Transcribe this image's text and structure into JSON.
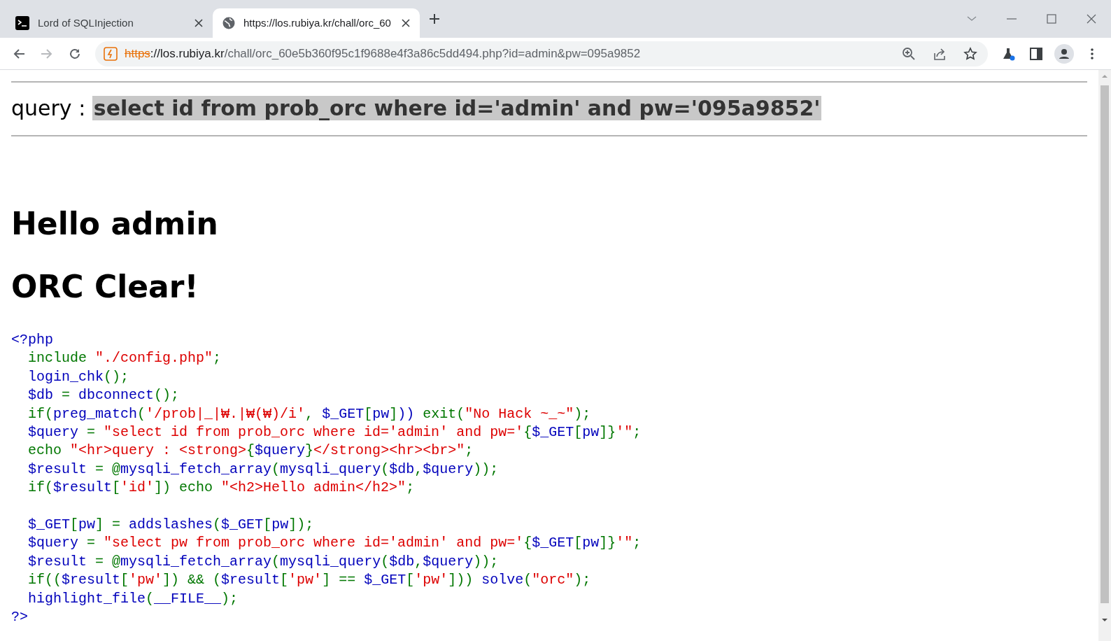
{
  "browser": {
    "tabs": [
      {
        "title": "Lord of SQLInjection",
        "selected": false
      },
      {
        "title": "https://los.rubiya.kr/chall/orc_60",
        "selected": true
      }
    ],
    "nav": {
      "back_enabled": true,
      "forward_enabled": false
    },
    "address": {
      "scheme": "https",
      "insecure": true,
      "host": "://los.rubiya.kr",
      "path": "/chall/orc_60e5b360f95c1f9688e4f3a86c5dd494.php?id=admin&pw=095a9852"
    }
  },
  "page": {
    "query": "query : **select id from prob_orc where id='admin' and pw='095a9852'**",
    "headings": [
      "Hello admin",
      "ORC Clear!"
    ],
    "code": [
      {
        "kind": "code",
        "tokens": [
          {
            "text": "<?php",
            "kind": "default"
          }
        ]
      },
      {
        "kind": "code",
        "tokens": [
          {
            "text": "  include ",
            "kind": "keyword"
          },
          {
            "text": "\"./config.php\"",
            "kind": "string"
          },
          {
            "text": ";",
            "kind": "keyword"
          }
        ]
      },
      {
        "kind": "code",
        "tokens": [
          {
            "text": "  login_chk",
            "kind": "default"
          },
          {
            "text": "();",
            "kind": "keyword"
          }
        ]
      },
      {
        "kind": "code",
        "tokens": [
          {
            "text": "  $db ",
            "kind": "default"
          },
          {
            "text": "= ",
            "kind": "keyword"
          },
          {
            "text": "dbconnect",
            "kind": "default"
          },
          {
            "text": "();",
            "kind": "keyword"
          }
        ]
      },
      {
        "kind": "code",
        "tokens": [
          {
            "text": "  if(",
            "kind": "keyword"
          },
          {
            "text": "preg_match",
            "kind": "default"
          },
          {
            "text": "(",
            "kind": "keyword"
          },
          {
            "text": "'/prob|_|₩.|₩(₩)/i'",
            "kind": "string"
          },
          {
            "text": ", ",
            "kind": "keyword"
          },
          {
            "text": "$_GET",
            "kind": "default"
          },
          {
            "text": "[",
            "kind": "keyword"
          },
          {
            "text": "pw",
            "kind": "default"
          },
          {
            "text": "]",
            "kind": "keyword"
          },
          {
            "text": "))",
            "kind": "default"
          },
          {
            "text": " exit(",
            "kind": "keyword"
          },
          {
            "text": "\"No Hack ~_~\"",
            "kind": "string"
          },
          {
            "text": ");",
            "kind": "keyword"
          }
        ]
      },
      {
        "kind": "code",
        "tokens": [
          {
            "text": "  $query ",
            "kind": "default"
          },
          {
            "text": "= ",
            "kind": "keyword"
          },
          {
            "text": "\"select id from prob_orc where id='admin' and pw='",
            "kind": "string"
          },
          {
            "text": "{",
            "kind": "keyword"
          },
          {
            "text": "$_GET",
            "kind": "default"
          },
          {
            "text": "[",
            "kind": "keyword"
          },
          {
            "text": "pw",
            "kind": "default"
          },
          {
            "text": "]}",
            "kind": "keyword"
          },
          {
            "text": "'\"",
            "kind": "string"
          },
          {
            "text": ";",
            "kind": "keyword"
          }
        ]
      },
      {
        "kind": "code",
        "tokens": [
          {
            "text": "  echo ",
            "kind": "keyword"
          },
          {
            "text": "\"<hr>query : <strong>",
            "kind": "string"
          },
          {
            "text": "{",
            "kind": "keyword"
          },
          {
            "text": "$query",
            "kind": "default"
          },
          {
            "text": "}",
            "kind": "keyword"
          },
          {
            "text": "</strong><hr><br>\"",
            "kind": "string"
          },
          {
            "text": ";",
            "kind": "keyword"
          }
        ]
      },
      {
        "kind": "code",
        "tokens": [
          {
            "text": "  $result ",
            "kind": "default"
          },
          {
            "text": "= @",
            "kind": "keyword"
          },
          {
            "text": "mysqli_fetch_array",
            "kind": "default"
          },
          {
            "text": "(",
            "kind": "keyword"
          },
          {
            "text": "mysqli_query",
            "kind": "default"
          },
          {
            "text": "(",
            "kind": "keyword"
          },
          {
            "text": "$db",
            "kind": "default"
          },
          {
            "text": ",",
            "kind": "keyword"
          },
          {
            "text": "$query",
            "kind": "default"
          },
          {
            "text": "));",
            "kind": "keyword"
          }
        ]
      },
      {
        "kind": "code",
        "tokens": [
          {
            "text": "  if(",
            "kind": "keyword"
          },
          {
            "text": "$result",
            "kind": "default"
          },
          {
            "text": "[",
            "kind": "keyword"
          },
          {
            "text": "'id'",
            "kind": "string"
          },
          {
            "text": "]) echo ",
            "kind": "keyword"
          },
          {
            "text": "\"<h2>Hello admin</h2>\"",
            "kind": "string"
          },
          {
            "text": ";",
            "kind": "keyword"
          }
        ]
      },
      {
        "kind": "blank"
      },
      {
        "kind": "code",
        "tokens": [
          {
            "text": "  $_GET",
            "kind": "default"
          },
          {
            "text": "[",
            "kind": "keyword"
          },
          {
            "text": "pw",
            "kind": "default"
          },
          {
            "text": "] = ",
            "kind": "keyword"
          },
          {
            "text": "addslashes",
            "kind": "default"
          },
          {
            "text": "(",
            "kind": "keyword"
          },
          {
            "text": "$_GET",
            "kind": "default"
          },
          {
            "text": "[",
            "kind": "keyword"
          },
          {
            "text": "pw",
            "kind": "default"
          },
          {
            "text": "]);",
            "kind": "keyword"
          }
        ]
      },
      {
        "kind": "code",
        "tokens": [
          {
            "text": "  $query ",
            "kind": "default"
          },
          {
            "text": "= ",
            "kind": "keyword"
          },
          {
            "text": "\"select pw from prob_orc where id='admin' and pw='",
            "kind": "string"
          },
          {
            "text": "{",
            "kind": "keyword"
          },
          {
            "text": "$_GET",
            "kind": "default"
          },
          {
            "text": "[",
            "kind": "keyword"
          },
          {
            "text": "pw",
            "kind": "default"
          },
          {
            "text": "]}",
            "kind": "keyword"
          },
          {
            "text": "'\"",
            "kind": "string"
          },
          {
            "text": ";",
            "kind": "keyword"
          }
        ]
      },
      {
        "kind": "code",
        "tokens": [
          {
            "text": "  $result ",
            "kind": "default"
          },
          {
            "text": "= @",
            "kind": "keyword"
          },
          {
            "text": "mysqli_fetch_array",
            "kind": "default"
          },
          {
            "text": "(",
            "kind": "keyword"
          },
          {
            "text": "mysqli_query",
            "kind": "default"
          },
          {
            "text": "(",
            "kind": "keyword"
          },
          {
            "text": "$db",
            "kind": "default"
          },
          {
            "text": ",",
            "kind": "keyword"
          },
          {
            "text": "$query",
            "kind": "default"
          },
          {
            "text": "));",
            "kind": "keyword"
          }
        ]
      },
      {
        "kind": "code",
        "tokens": [
          {
            "text": "  if((",
            "kind": "keyword"
          },
          {
            "text": "$result",
            "kind": "default"
          },
          {
            "text": "[",
            "kind": "keyword"
          },
          {
            "text": "'pw'",
            "kind": "string"
          },
          {
            "text": "]) && (",
            "kind": "keyword"
          },
          {
            "text": "$result",
            "kind": "default"
          },
          {
            "text": "[",
            "kind": "keyword"
          },
          {
            "text": "'pw'",
            "kind": "string"
          },
          {
            "text": "] == ",
            "kind": "keyword"
          },
          {
            "text": "$_GET",
            "kind": "default"
          },
          {
            "text": "[",
            "kind": "keyword"
          },
          {
            "text": "'pw'",
            "kind": "string"
          },
          {
            "text": "])) ",
            "kind": "keyword"
          },
          {
            "text": "solve",
            "kind": "default"
          },
          {
            "text": "(",
            "kind": "keyword"
          },
          {
            "text": "\"orc\"",
            "kind": "string"
          },
          {
            "text": ");",
            "kind": "keyword"
          }
        ]
      },
      {
        "kind": "code",
        "tokens": [
          {
            "text": "  highlight_file",
            "kind": "default"
          },
          {
            "text": "(",
            "kind": "keyword"
          },
          {
            "text": "__FILE__",
            "kind": "default"
          },
          {
            "text": ");",
            "kind": "keyword"
          }
        ]
      },
      {
        "kind": "code",
        "tokens": [
          {
            "text": "?>",
            "kind": "default"
          }
        ]
      }
    ]
  }
}
